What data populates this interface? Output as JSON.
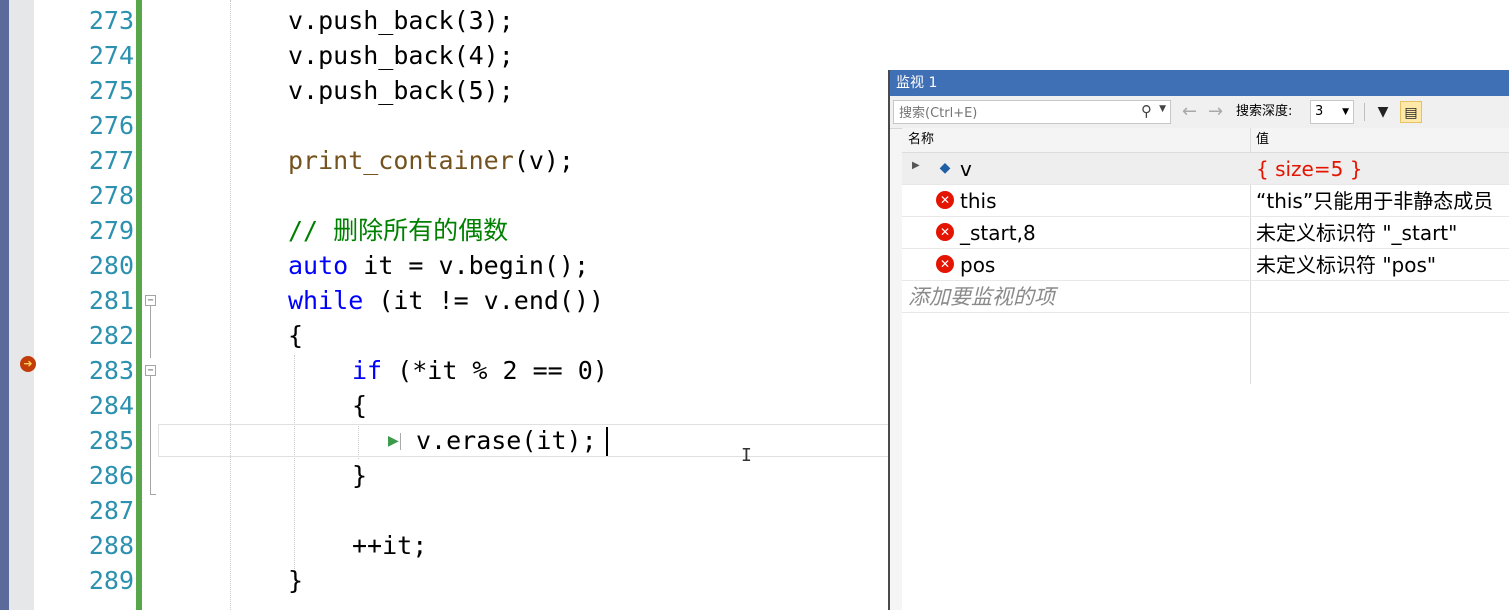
{
  "editor": {
    "line_numbers": [
      "273",
      "274",
      "275",
      "276",
      "277",
      "278",
      "279",
      "280",
      "281",
      "282",
      "283",
      "284",
      "285",
      "286",
      "287",
      "288",
      "289"
    ],
    "code": {
      "l273": "v.push_back(3);",
      "l274": "v.push_back(4);",
      "l275": "v.push_back(5);",
      "l277_fn": "print_container",
      "l277_rest": "(v);",
      "l279_comment": "// 删除所有的偶数",
      "l280_kw": "auto",
      "l280_rest": " it = v.begin();",
      "l281_kw": "while",
      "l281_rest": " (it != v.end())",
      "l282": "{",
      "l283_kw": "if",
      "l283_rest": " (*it % 2 == 0)",
      "l284": "{",
      "l285": "v.erase(it);",
      "l286": "}",
      "l288": "++it;",
      "l289": "}"
    },
    "colors": {
      "keyword": "#0000ff",
      "comment": "#008000",
      "line_number": "#2b91af",
      "change_bar": "#57a64a"
    }
  },
  "watch": {
    "title": "监视 1",
    "search_placeholder": "搜索(Ctrl+E)",
    "depth_label": "搜索深度:",
    "depth_value": "3",
    "columns": {
      "name": "名称",
      "value": "值"
    },
    "rows": [
      {
        "name": "v",
        "value": "{ size=5 }",
        "icon": "object-icon",
        "changed": true
      },
      {
        "name": "this",
        "value": "“this”只能用于非静态成员",
        "icon": "error-icon",
        "changed": false
      },
      {
        "name": "_start,8",
        "value": "未定义标识符 \"_start\"",
        "icon": "error-icon",
        "changed": false
      },
      {
        "name": "pos",
        "value": "未定义标识符 \"pos\"",
        "icon": "error-icon",
        "changed": false
      }
    ],
    "add_item_placeholder": "添加要监视的项",
    "colors": {
      "title_bar": "#3f6fb5",
      "error": "#e51400"
    }
  }
}
